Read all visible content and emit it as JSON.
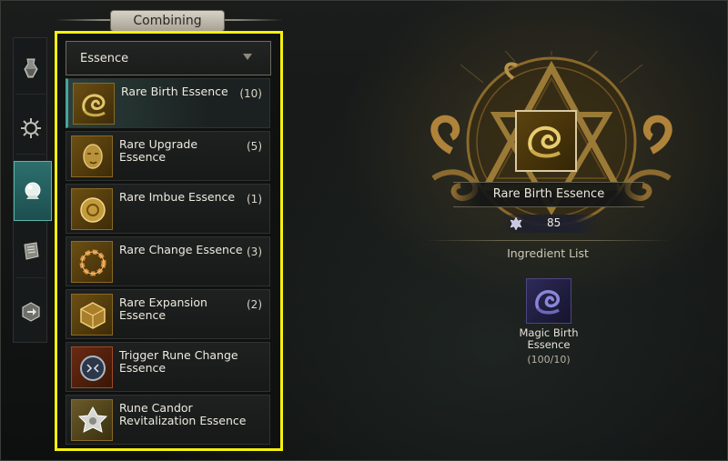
{
  "header": {
    "title": "Combining"
  },
  "side_tabs": [
    {
      "icon": "potion-bottle-icon",
      "active": false
    },
    {
      "icon": "sun-gear-icon",
      "active": false
    },
    {
      "icon": "orb-icon",
      "active": true
    },
    {
      "icon": "scroll-icon",
      "active": false
    },
    {
      "icon": "cube-exchange-icon",
      "active": false
    }
  ],
  "filter": {
    "selected": "Essence"
  },
  "items": [
    {
      "name": "Rare Birth Essence",
      "count": "(10)",
      "icon": "serpent-icon",
      "selected": true
    },
    {
      "name": "Rare Upgrade Essence",
      "count": "(5)",
      "icon": "face-relief-icon",
      "selected": false
    },
    {
      "name": "Rare Imbue Essence",
      "count": "(1)",
      "icon": "gold-orb-icon",
      "selected": false
    },
    {
      "name": "Rare Change Essence",
      "count": "(3)",
      "icon": "ring-of-links-icon",
      "selected": false
    },
    {
      "name": "Rare Expansion Essence",
      "count": "(2)",
      "icon": "cube-icon",
      "selected": false
    },
    {
      "name": "Trigger Rune Change Essence",
      "count": "",
      "icon": "rune-sphere-icon",
      "selected": false
    },
    {
      "name": "Rune Candor Revitalization Essence",
      "count": "",
      "icon": "silver-rosette-icon",
      "selected": false
    }
  ],
  "detail": {
    "name": "Rare Birth Essence",
    "cost": "85",
    "cost_icon": "fleur-crest-icon",
    "ingredient_title": "Ingredient List",
    "ingredient": {
      "name": "Magic Birth Essence",
      "quantity": "(100/10)",
      "icon": "blue-serpent-icon"
    }
  },
  "colors": {
    "highlight": "#f4f10c",
    "active_tab": "#2c6f6e",
    "gold": "#c79a3a"
  }
}
